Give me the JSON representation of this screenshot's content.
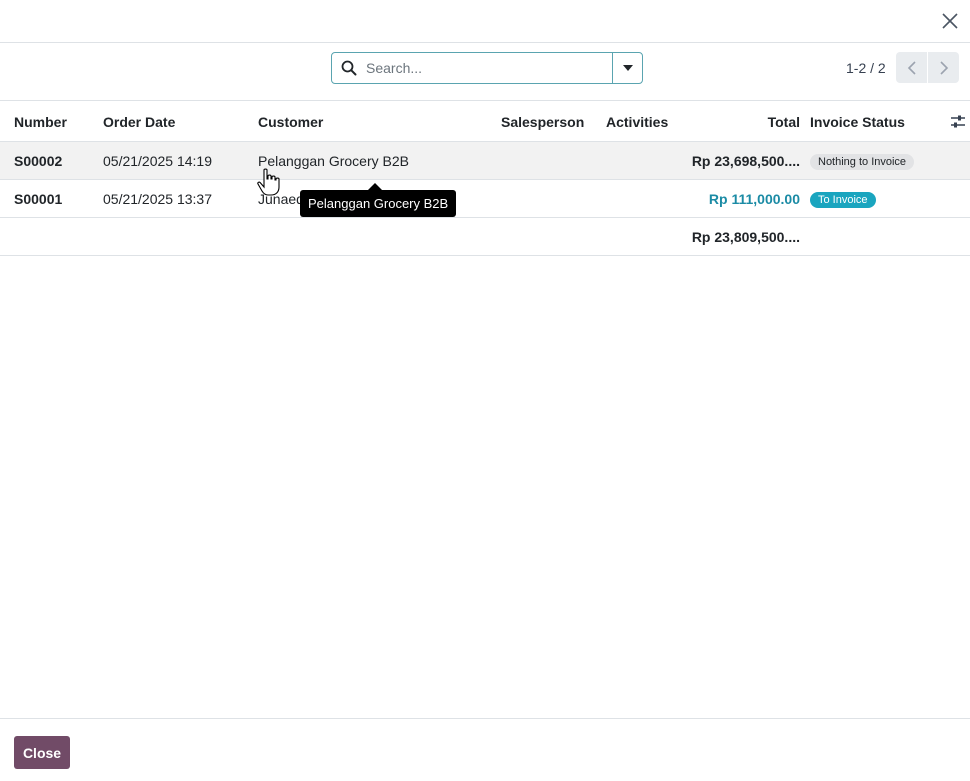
{
  "search": {
    "placeholder": "Search..."
  },
  "pager": {
    "value": "1-2 / 2"
  },
  "columns": {
    "number": "Number",
    "order_date": "Order Date",
    "customer": "Customer",
    "salesperson": "Salesperson",
    "activities": "Activities",
    "total": "Total",
    "invoice_status": "Invoice Status"
  },
  "rows": [
    {
      "number": "S00002",
      "order_date": "05/21/2025 14:19",
      "customer": "Pelanggan Grocery B2B",
      "total": "Rp 23,698,500....",
      "invoice_status": "Nothing to Invoice"
    },
    {
      "number": "S00001",
      "order_date": "05/21/2025 13:37",
      "customer": "Junaedi",
      "total": "Rp 111,000.00",
      "invoice_status": "To Invoice"
    }
  ],
  "footer_total": "Rp 23,809,500....",
  "tooltip": {
    "text": "Pelanggan Grocery B2B"
  },
  "footer": {
    "close_label": "Close"
  },
  "colors": {
    "brand": "#714b67",
    "accent": "#1aa5bf",
    "total_blue": "#1b8ba5"
  }
}
